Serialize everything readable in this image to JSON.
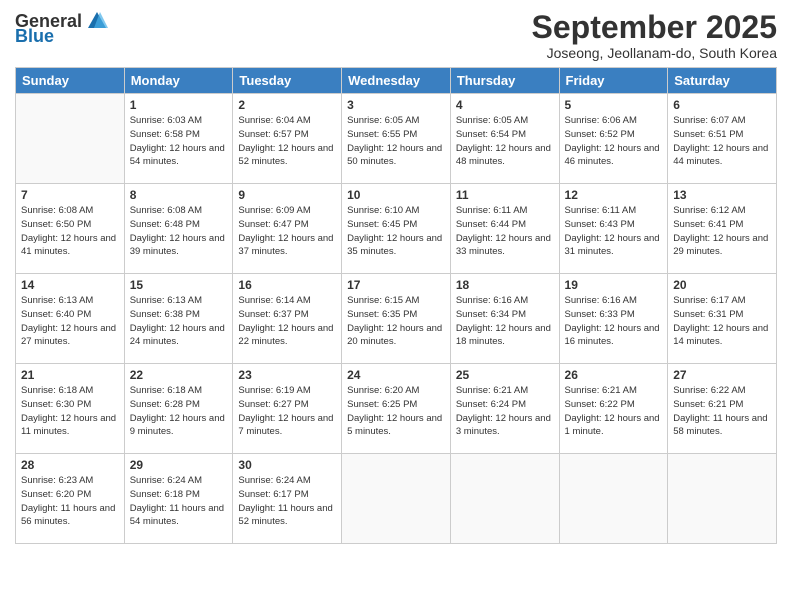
{
  "header": {
    "logo_general": "General",
    "logo_blue": "Blue",
    "month_title": "September 2025",
    "location": "Joseong, Jeollanam-do, South Korea"
  },
  "weekdays": [
    "Sunday",
    "Monday",
    "Tuesday",
    "Wednesday",
    "Thursday",
    "Friday",
    "Saturday"
  ],
  "weeks": [
    [
      {
        "day": "",
        "sunrise": "",
        "sunset": "",
        "daylight": ""
      },
      {
        "day": "1",
        "sunrise": "Sunrise: 6:03 AM",
        "sunset": "Sunset: 6:58 PM",
        "daylight": "Daylight: 12 hours and 54 minutes."
      },
      {
        "day": "2",
        "sunrise": "Sunrise: 6:04 AM",
        "sunset": "Sunset: 6:57 PM",
        "daylight": "Daylight: 12 hours and 52 minutes."
      },
      {
        "day": "3",
        "sunrise": "Sunrise: 6:05 AM",
        "sunset": "Sunset: 6:55 PM",
        "daylight": "Daylight: 12 hours and 50 minutes."
      },
      {
        "day": "4",
        "sunrise": "Sunrise: 6:05 AM",
        "sunset": "Sunset: 6:54 PM",
        "daylight": "Daylight: 12 hours and 48 minutes."
      },
      {
        "day": "5",
        "sunrise": "Sunrise: 6:06 AM",
        "sunset": "Sunset: 6:52 PM",
        "daylight": "Daylight: 12 hours and 46 minutes."
      },
      {
        "day": "6",
        "sunrise": "Sunrise: 6:07 AM",
        "sunset": "Sunset: 6:51 PM",
        "daylight": "Daylight: 12 hours and 44 minutes."
      }
    ],
    [
      {
        "day": "7",
        "sunrise": "Sunrise: 6:08 AM",
        "sunset": "Sunset: 6:50 PM",
        "daylight": "Daylight: 12 hours and 41 minutes."
      },
      {
        "day": "8",
        "sunrise": "Sunrise: 6:08 AM",
        "sunset": "Sunset: 6:48 PM",
        "daylight": "Daylight: 12 hours and 39 minutes."
      },
      {
        "day": "9",
        "sunrise": "Sunrise: 6:09 AM",
        "sunset": "Sunset: 6:47 PM",
        "daylight": "Daylight: 12 hours and 37 minutes."
      },
      {
        "day": "10",
        "sunrise": "Sunrise: 6:10 AM",
        "sunset": "Sunset: 6:45 PM",
        "daylight": "Daylight: 12 hours and 35 minutes."
      },
      {
        "day": "11",
        "sunrise": "Sunrise: 6:11 AM",
        "sunset": "Sunset: 6:44 PM",
        "daylight": "Daylight: 12 hours and 33 minutes."
      },
      {
        "day": "12",
        "sunrise": "Sunrise: 6:11 AM",
        "sunset": "Sunset: 6:43 PM",
        "daylight": "Daylight: 12 hours and 31 minutes."
      },
      {
        "day": "13",
        "sunrise": "Sunrise: 6:12 AM",
        "sunset": "Sunset: 6:41 PM",
        "daylight": "Daylight: 12 hours and 29 minutes."
      }
    ],
    [
      {
        "day": "14",
        "sunrise": "Sunrise: 6:13 AM",
        "sunset": "Sunset: 6:40 PM",
        "daylight": "Daylight: 12 hours and 27 minutes."
      },
      {
        "day": "15",
        "sunrise": "Sunrise: 6:13 AM",
        "sunset": "Sunset: 6:38 PM",
        "daylight": "Daylight: 12 hours and 24 minutes."
      },
      {
        "day": "16",
        "sunrise": "Sunrise: 6:14 AM",
        "sunset": "Sunset: 6:37 PM",
        "daylight": "Daylight: 12 hours and 22 minutes."
      },
      {
        "day": "17",
        "sunrise": "Sunrise: 6:15 AM",
        "sunset": "Sunset: 6:35 PM",
        "daylight": "Daylight: 12 hours and 20 minutes."
      },
      {
        "day": "18",
        "sunrise": "Sunrise: 6:16 AM",
        "sunset": "Sunset: 6:34 PM",
        "daylight": "Daylight: 12 hours and 18 minutes."
      },
      {
        "day": "19",
        "sunrise": "Sunrise: 6:16 AM",
        "sunset": "Sunset: 6:33 PM",
        "daylight": "Daylight: 12 hours and 16 minutes."
      },
      {
        "day": "20",
        "sunrise": "Sunrise: 6:17 AM",
        "sunset": "Sunset: 6:31 PM",
        "daylight": "Daylight: 12 hours and 14 minutes."
      }
    ],
    [
      {
        "day": "21",
        "sunrise": "Sunrise: 6:18 AM",
        "sunset": "Sunset: 6:30 PM",
        "daylight": "Daylight: 12 hours and 11 minutes."
      },
      {
        "day": "22",
        "sunrise": "Sunrise: 6:18 AM",
        "sunset": "Sunset: 6:28 PM",
        "daylight": "Daylight: 12 hours and 9 minutes."
      },
      {
        "day": "23",
        "sunrise": "Sunrise: 6:19 AM",
        "sunset": "Sunset: 6:27 PM",
        "daylight": "Daylight: 12 hours and 7 minutes."
      },
      {
        "day": "24",
        "sunrise": "Sunrise: 6:20 AM",
        "sunset": "Sunset: 6:25 PM",
        "daylight": "Daylight: 12 hours and 5 minutes."
      },
      {
        "day": "25",
        "sunrise": "Sunrise: 6:21 AM",
        "sunset": "Sunset: 6:24 PM",
        "daylight": "Daylight: 12 hours and 3 minutes."
      },
      {
        "day": "26",
        "sunrise": "Sunrise: 6:21 AM",
        "sunset": "Sunset: 6:22 PM",
        "daylight": "Daylight: 12 hours and 1 minute."
      },
      {
        "day": "27",
        "sunrise": "Sunrise: 6:22 AM",
        "sunset": "Sunset: 6:21 PM",
        "daylight": "Daylight: 11 hours and 58 minutes."
      }
    ],
    [
      {
        "day": "28",
        "sunrise": "Sunrise: 6:23 AM",
        "sunset": "Sunset: 6:20 PM",
        "daylight": "Daylight: 11 hours and 56 minutes."
      },
      {
        "day": "29",
        "sunrise": "Sunrise: 6:24 AM",
        "sunset": "Sunset: 6:18 PM",
        "daylight": "Daylight: 11 hours and 54 minutes."
      },
      {
        "day": "30",
        "sunrise": "Sunrise: 6:24 AM",
        "sunset": "Sunset: 6:17 PM",
        "daylight": "Daylight: 11 hours and 52 minutes."
      },
      {
        "day": "",
        "sunrise": "",
        "sunset": "",
        "daylight": ""
      },
      {
        "day": "",
        "sunrise": "",
        "sunset": "",
        "daylight": ""
      },
      {
        "day": "",
        "sunrise": "",
        "sunset": "",
        "daylight": ""
      },
      {
        "day": "",
        "sunrise": "",
        "sunset": "",
        "daylight": ""
      }
    ]
  ]
}
